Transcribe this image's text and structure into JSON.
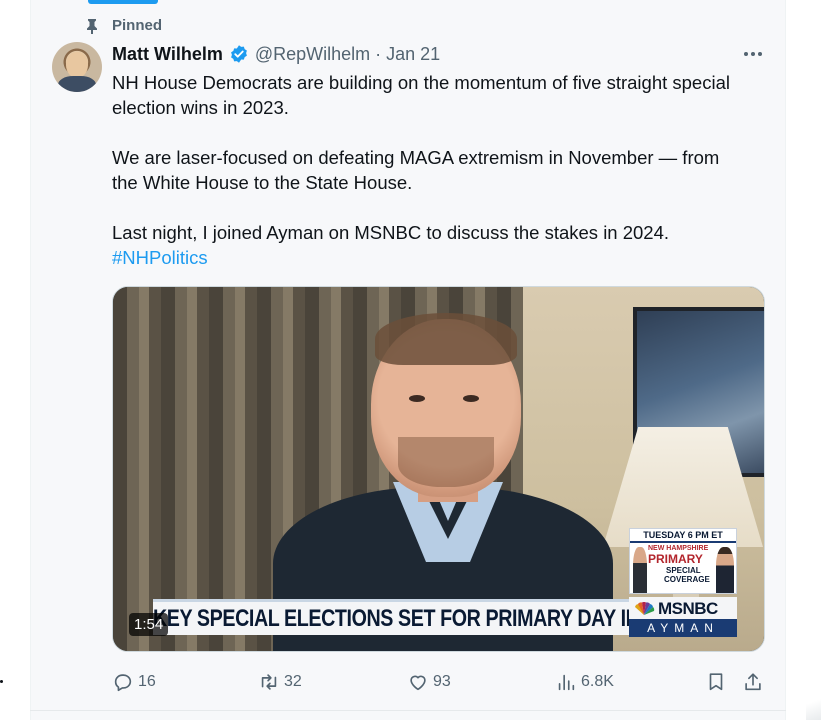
{
  "pinned": {
    "label": "Pinned",
    "icon": "pin-icon"
  },
  "post": {
    "author_name": "Matt Wilhelm",
    "verified": true,
    "handle": "@RepWilhelm",
    "separator": "·",
    "date": "Jan 21",
    "text": {
      "line1": "NH House Democrats are building on the momentum of five straight special",
      "line2": "election wins in 2023.",
      "line3": "We are laser-focused on defeating MAGA extremism in November — from",
      "line4": "the White House to the State House.",
      "line5": "Last night, I joined Ayman on MSNBC to discuss the stakes in 2024.",
      "hashtag": "#NHPolitics"
    }
  },
  "video": {
    "duration": "1:54",
    "lower_third": "KEY SPECIAL ELECTIONS SET FOR PRIMARY DAY IN NH",
    "promo": {
      "time": "TUESDAY 6 PM ET",
      "line1": "NEW HAMPSHIRE",
      "line2": "PRIMARY",
      "line3": "SPECIAL",
      "line4": "COVERAGE"
    },
    "network": {
      "name": "MSNBC",
      "host": "AYMAN"
    }
  },
  "actions": {
    "replies": "16",
    "reposts": "32",
    "likes": "93",
    "views": "6.8K"
  },
  "colors": {
    "accent": "#1d9bf0",
    "text_primary": "#0f1419",
    "text_secondary": "#536471"
  }
}
